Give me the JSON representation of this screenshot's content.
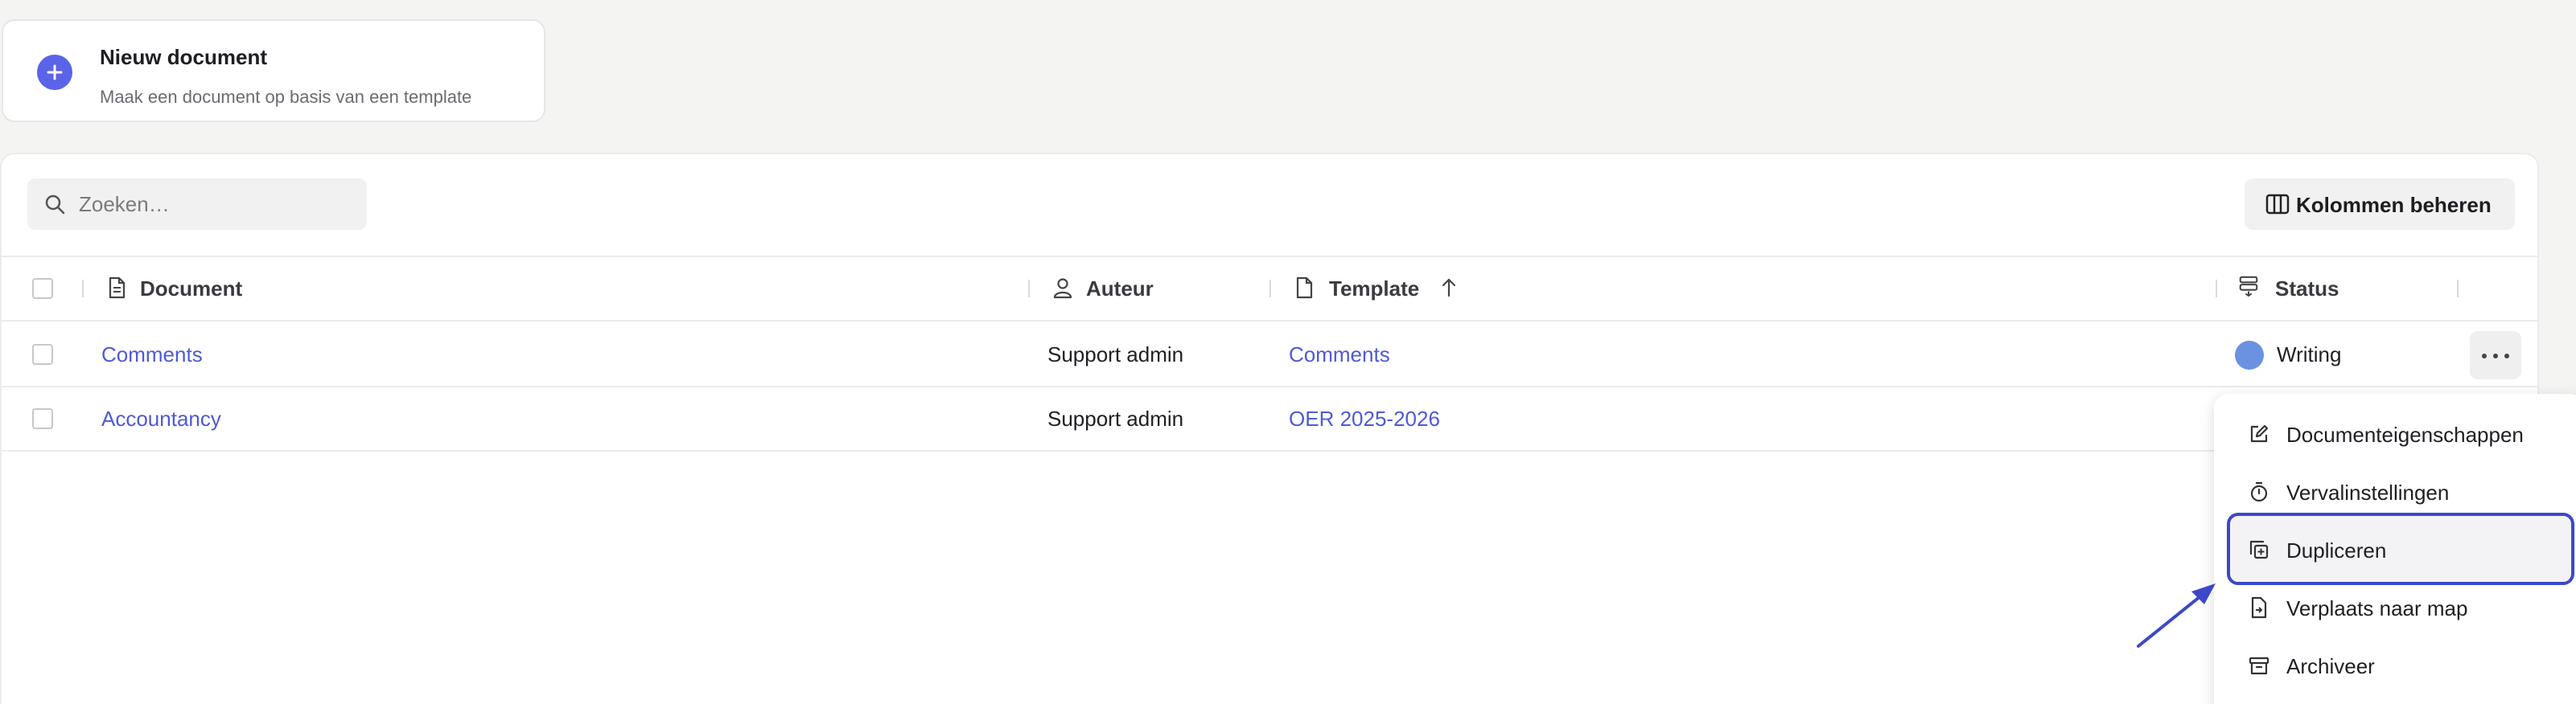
{
  "new_document": {
    "title": "Nieuw document",
    "subtitle": "Maak een document op basis van een template",
    "icon": "plus-icon",
    "accent": "#5b63e8"
  },
  "toolbar": {
    "search_placeholder": "Zoeken…",
    "search_value": "",
    "manage_columns_label": "Kolommen beheren"
  },
  "table": {
    "headers": {
      "document": "Document",
      "author": "Auteur",
      "template": "Template",
      "status": "Status"
    },
    "sort": {
      "column": "template",
      "direction": "ascending"
    },
    "rows": [
      {
        "document": "Comments",
        "author": "Support admin",
        "template": "Comments",
        "status": "Writing",
        "status_color": "#6b92e0"
      },
      {
        "document": "Accountancy",
        "author": "Support admin",
        "template": "OER 2025-2026",
        "status": "",
        "status_color": ""
      }
    ]
  },
  "context_menu": {
    "items": [
      {
        "label": "Documenteigenschappen",
        "icon": "edit-icon"
      },
      {
        "label": "Vervalinstellingen",
        "icon": "timer-icon"
      },
      {
        "label": "Dupliceren",
        "icon": "duplicate-icon",
        "highlighted": true
      },
      {
        "label": "Verplaats naar map",
        "icon": "move-file-icon"
      },
      {
        "label": "Archiveer",
        "icon": "archive-icon"
      }
    ]
  },
  "colors": {
    "link": "#4f59d6",
    "highlight_border": "#3d48c8",
    "annotation_arrow": "#3d48c8"
  }
}
